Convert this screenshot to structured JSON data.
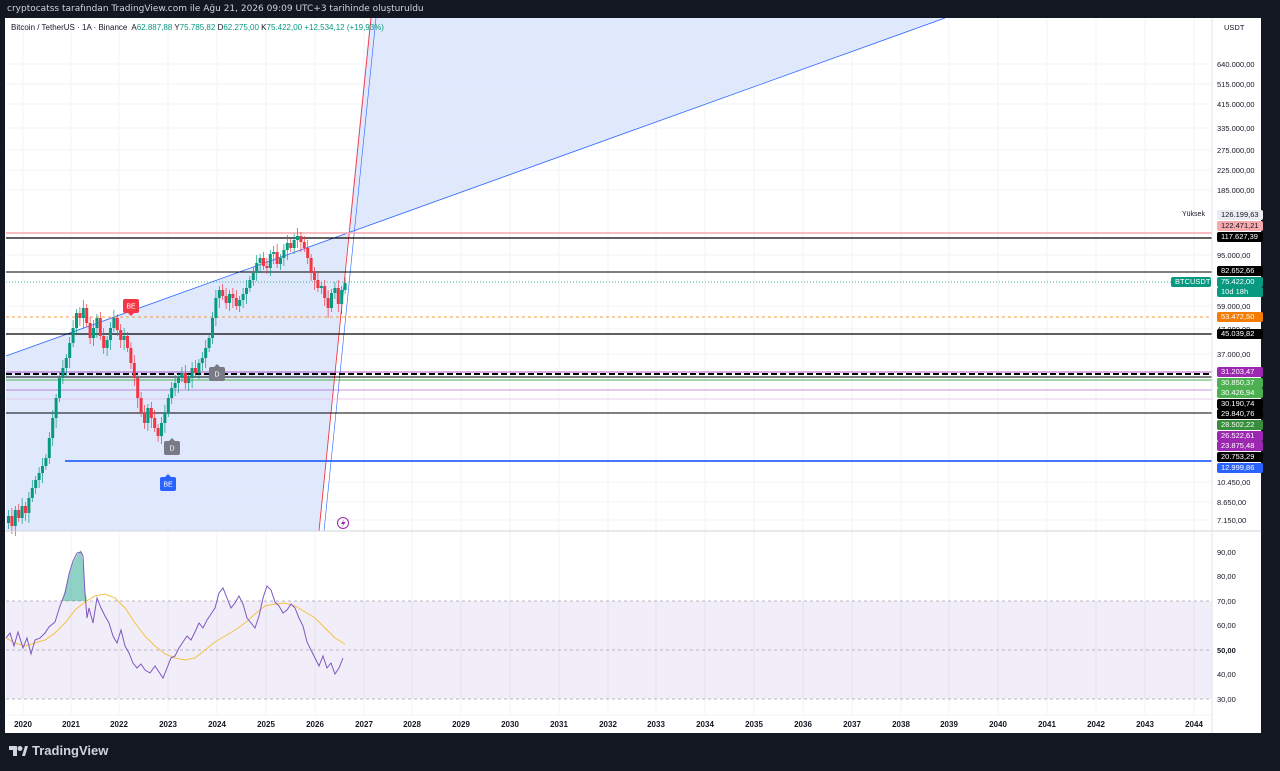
{
  "attribution": "cryptocatss tarafından TradingView.com ile Ağu 21, 2026 09:09 UTC+3 tarihinde oluşturuldu",
  "symbol": {
    "name": "Bitcoin / TetherUS · 1A · Binance",
    "open_label": "A",
    "open": "62.887,88",
    "high_label": "Y",
    "high": "75.785,82",
    "low_label": "D",
    "low": "62.275,00",
    "close_label": "K",
    "close": "75.422,00",
    "change": "+12.534,12 (+19,93%)"
  },
  "currency": "USDT",
  "price_axis_ticks": [
    "640.000,00",
    "515.000,00",
    "415.000,00",
    "335.000,00",
    "275.000,00",
    "225.000,00",
    "185.000,00",
    "95.000,00",
    "59.000,00",
    "47.000,00",
    "37.000,00",
    "10.450,00",
    "8.650,00",
    "7.150,00"
  ],
  "high_label": "Yüksek",
  "price_labels": [
    {
      "text": "126.199,63",
      "bg": "#e9ecf3",
      "fg": "#131722"
    },
    {
      "text": "122.471,21",
      "bg": "#f7a9ad",
      "fg": "#131722"
    },
    {
      "text": "117.627,39",
      "bg": "#000000",
      "fg": "#ffffff"
    },
    {
      "text": "82.652,66",
      "bg": "#000000",
      "fg": "#ffffff"
    },
    {
      "text": "75.422,00",
      "bg": "#089981",
      "fg": "#ffffff"
    },
    {
      "text": "10d 18h",
      "bg": "#089981",
      "fg": "#ffffff"
    },
    {
      "text": "53.472,50",
      "bg": "#f57c00",
      "fg": "#ffffff"
    },
    {
      "text": "45.039,82",
      "bg": "#000000",
      "fg": "#ffffff"
    },
    {
      "text": "31.203,47",
      "bg": "#9c27b0",
      "fg": "#ffffff"
    },
    {
      "text": "30.850,37",
      "bg": "#4caf50",
      "fg": "#ffffff"
    },
    {
      "text": "30.426,94",
      "bg": "#4caf50",
      "fg": "#ffffff"
    },
    {
      "text": "30.190,74",
      "bg": "#000000",
      "fg": "#ffffff"
    },
    {
      "text": "29.840,76",
      "bg": "#000000",
      "fg": "#ffffff"
    },
    {
      "text": "28.502,22",
      "bg": "#388e3c",
      "fg": "#ffffff"
    },
    {
      "text": "26.522,61",
      "bg": "#9c27b0",
      "fg": "#ffffff"
    },
    {
      "text": "23.875,48",
      "bg": "#9c27b0",
      "fg": "#ffffff"
    },
    {
      "text": "20.753,29",
      "bg": "#000000",
      "fg": "#ffffff"
    },
    {
      "text": "12.999,86",
      "bg": "#2962ff",
      "fg": "#ffffff"
    }
  ],
  "ticker_tag": "BTCUSDT",
  "rsi_ticks": [
    "90,00",
    "80,00",
    "70,00",
    "60,00",
    "50,00",
    "40,00",
    "30,00"
  ],
  "years": [
    "2020",
    "2021",
    "2022",
    "2023",
    "2024",
    "2025",
    "2026",
    "2027",
    "2028",
    "2029",
    "2030",
    "2031",
    "2032",
    "2033",
    "2034",
    "2035",
    "2036",
    "2037",
    "2038",
    "2039",
    "2040",
    "2041",
    "2042",
    "2043",
    "2044"
  ],
  "markers": [
    {
      "text": "BE",
      "color": "#f23645"
    },
    {
      "text": "D",
      "color": "#787b86"
    },
    {
      "text": "D",
      "color": "#787b86"
    },
    {
      "text": "BE",
      "color": "#2962ff"
    }
  ],
  "brand": "TradingView",
  "colors": {
    "up": "#089981",
    "down": "#f23645",
    "rsi": "#7e57c2",
    "rsi_ma": "#f5c242",
    "channel": "#2962ff"
  }
}
